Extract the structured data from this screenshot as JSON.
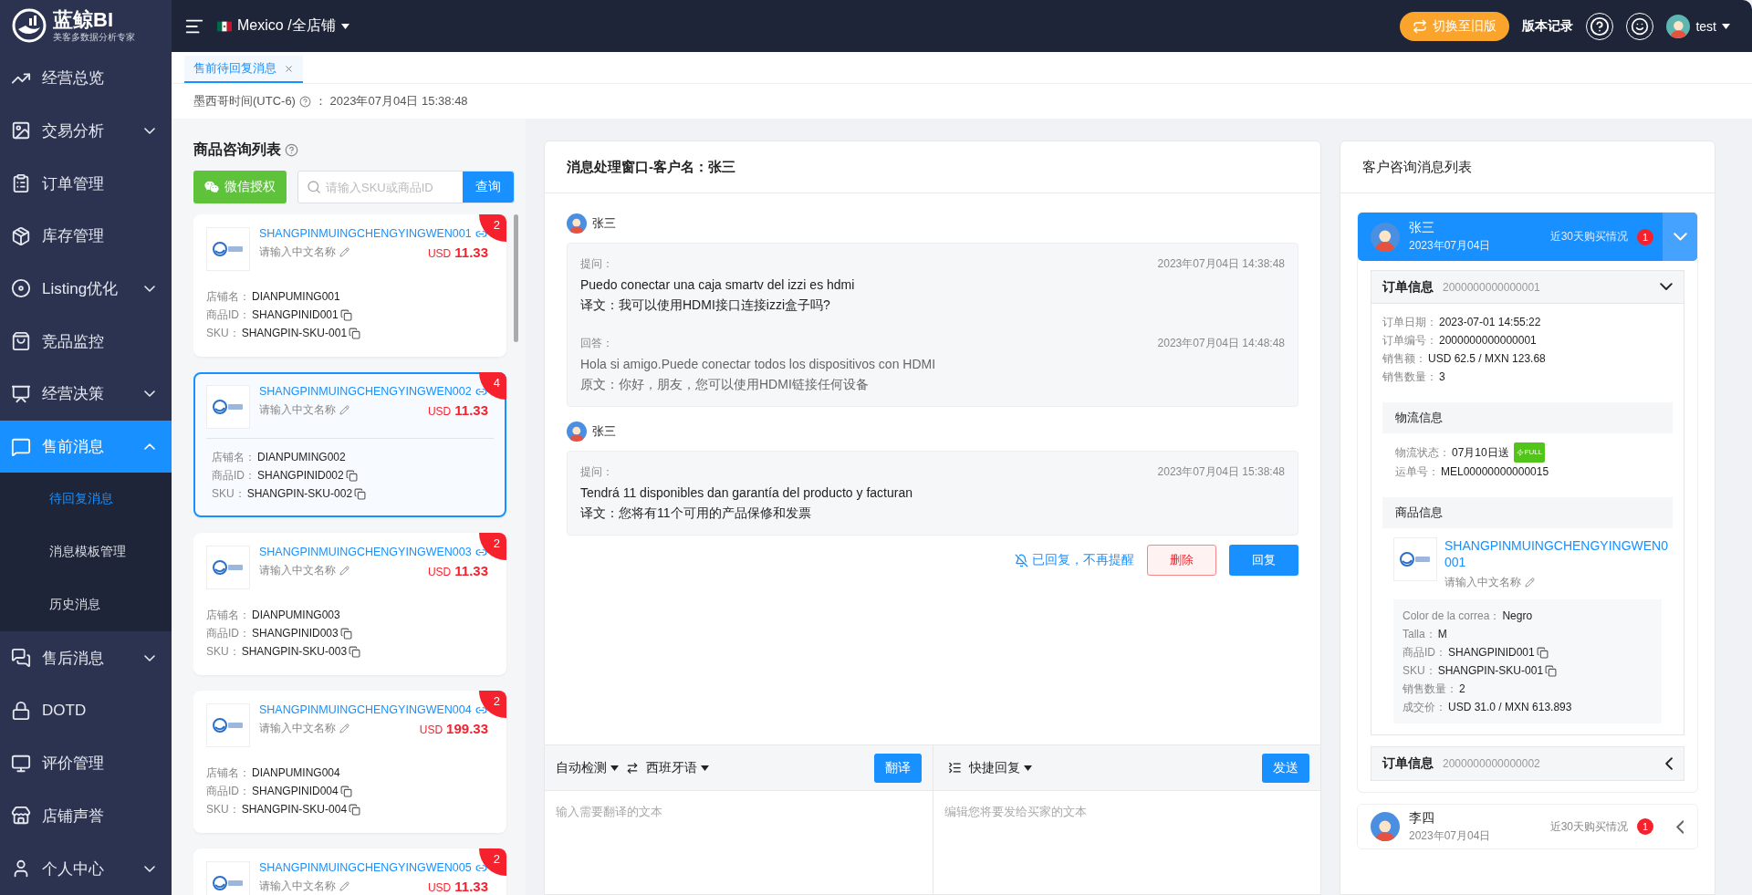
{
  "sidebar": {
    "logo": {
      "title": "蓝鲸BI",
      "subtitle": "美客多数据分析专家"
    },
    "items": [
      {
        "label": "经营总览",
        "selected": false
      },
      {
        "label": "交易分析",
        "expanded": false,
        "selected": false
      },
      {
        "label": "订单管理",
        "selected": false
      },
      {
        "label": "库存管理",
        "selected": false
      },
      {
        "label": "Listing优化",
        "expanded": false,
        "selected": false
      },
      {
        "label": "竞品监控",
        "selected": false
      },
      {
        "label": "经营决策",
        "expanded": false,
        "selected": false
      },
      {
        "label": "售前消息",
        "expanded": true,
        "selected": true,
        "children": [
          {
            "label": "待回复消息",
            "selected": true
          },
          {
            "label": "消息模板管理",
            "selected": false
          },
          {
            "label": "历史消息",
            "selected": false
          }
        ]
      },
      {
        "label": "售后消息",
        "expanded": false,
        "selected": false
      },
      {
        "label": "DOTD",
        "selected": false
      },
      {
        "label": "评价管理",
        "selected": false
      },
      {
        "label": "店铺声誉",
        "selected": false
      },
      {
        "label": "个人中心",
        "expanded": false,
        "selected": false
      }
    ]
  },
  "topbar": {
    "store": "Mexico /全店铺",
    "switch_button": "切换至旧版",
    "version_link": "版本记录",
    "user": "test"
  },
  "tabs": [
    {
      "label": "售前待回复消息",
      "selected": true
    }
  ],
  "time": {
    "label": "墨西哥时间(UTC-6)",
    "value": "： 2023年07月04日 15:38:48"
  },
  "product_list": {
    "title": "商品咨询列表",
    "wechat_button": "微信授权",
    "search_placeholder": "请输入SKU或商品ID",
    "search_button": "查询",
    "products": [
      {
        "title": "SHANGPINMUINGCHENGYINGWEN001",
        "name_placeholder": "请输入中文名称",
        "currency": "USD",
        "price": "11.33",
        "badge": "2",
        "selected": false,
        "fields": [
          {
            "label": "店铺名：",
            "value": "DIANPUMING001"
          },
          {
            "label": "商品ID：",
            "value": "SHANGPINID001",
            "copyable": true
          },
          {
            "label": "SKU：",
            "value": "SHANGPIN-SKU-001",
            "copyable": true
          }
        ]
      },
      {
        "title": "SHANGPINMUINGCHENGYINGWEN002",
        "name_placeholder": "请输入中文名称",
        "currency": "USD",
        "price": "11.33",
        "badge": "4",
        "selected": true,
        "fields": [
          {
            "label": "店铺名：",
            "value": "DIANPUMING002"
          },
          {
            "label": "商品ID：",
            "value": "SHANGPINID002",
            "copyable": true
          },
          {
            "label": "SKU：",
            "value": "SHANGPIN-SKU-002",
            "copyable": true
          }
        ]
      },
      {
        "title": "SHANGPINMUINGCHENGYINGWEN003",
        "name_placeholder": "请输入中文名称",
        "currency": "USD",
        "price": "11.33",
        "badge": "2",
        "selected": false,
        "fields": [
          {
            "label": "店铺名：",
            "value": "DIANPUMING003"
          },
          {
            "label": "商品ID：",
            "value": "SHANGPINID003",
            "copyable": true
          },
          {
            "label": "SKU：",
            "value": "SHANGPIN-SKU-003",
            "copyable": true
          }
        ]
      },
      {
        "title": "SHANGPINMUINGCHENGYINGWEN004",
        "name_placeholder": "请输入中文名称",
        "currency": "USD",
        "price": "199.33",
        "badge": "2",
        "selected": false,
        "fields": [
          {
            "label": "店铺名：",
            "value": "DIANPUMING004"
          },
          {
            "label": "商品ID：",
            "value": "SHANGPINID004",
            "copyable": true
          },
          {
            "label": "SKU：",
            "value": "SHANGPIN-SKU-004",
            "copyable": true
          }
        ]
      },
      {
        "title": "SHANGPINMUINGCHENGYINGWEN005",
        "name_placeholder": "请输入中文名称",
        "currency": "USD",
        "price": "11.33",
        "badge": "2",
        "selected": false
      }
    ]
  },
  "message_window": {
    "title": "消息处理窗口-客户名：张三",
    "threads": [
      {
        "customer": "张三",
        "entries": [
          {
            "kind": "question",
            "label": "提问：",
            "time": "2023年07月04日 14:38:48",
            "text": "Puedo conectar una caja smartv del izzi es hdmi",
            "translation_label": "译文：",
            "translation": "我可以使用HDMI接口连接izzi盒子吗?"
          },
          {
            "kind": "answer",
            "label": "回答：",
            "time": "2023年07月04日 14:48:48",
            "text": "Hola si amigo.Puede conectar todos los dispositivos con HDMI",
            "translation_label": "原文：",
            "translation": "你好，朋友，您可以使用HDMI链接任何设备"
          }
        ]
      },
      {
        "customer": "张三",
        "entries": [
          {
            "kind": "question",
            "label": "提问：",
            "time": "2023年07月04日 15:38:48",
            "text": "Tendrá 11 disponibles dan garantía del producto y facturan",
            "translation_label": "译文：",
            "translation": "您将有11个可用的产品保修和发票"
          }
        ]
      }
    ],
    "mute_link": "已回复，不再提醒",
    "delete_button": "删除",
    "reply_button": "回复",
    "translator": {
      "source_language": "自动检测",
      "target_language": "西班牙语",
      "translate_button": "翻译",
      "placeholder": "输入需要翻译的文本"
    },
    "composer": {
      "quick_reply": "快捷回复",
      "send_button": "发送",
      "placeholder": "编辑您将要发给买家的文本"
    }
  },
  "customer_list": {
    "title": "客户咨询消息列表",
    "customers": [
      {
        "name": "张三",
        "date": "2023年07月04日",
        "purchase_link": "近30天购买情况",
        "badge": "1",
        "expanded": true,
        "orders": [
          {
            "label": "订单信息",
            "number": "2000000000000001",
            "expanded": true,
            "fields": [
              {
                "label": "订单日期：",
                "value": "2023-07-01 14:55:22"
              },
              {
                "label": "订单编号：",
                "value": "2000000000000001"
              },
              {
                "label": "销售额：",
                "value": "USD 62.5 / MXN 123.68"
              },
              {
                "label": "销售数量：",
                "value": "3"
              }
            ],
            "logistics": {
              "title": "物流信息",
              "fields": [
                {
                  "label": "物流状态：",
                  "value": "07月10日送",
                  "tag": "FULL"
                },
                {
                  "label": "运单号：",
                  "value": "MEL00000000000015"
                }
              ]
            },
            "goods": {
              "title": "商品信息",
              "items": [
                {
                  "title": "SHANGPINMUINGCHENGYINGWEN0001",
                  "name_placeholder": "请输入中文名称",
                  "attributes": [
                    {
                      "label": "Color de la correa：",
                      "value": "Negro"
                    },
                    {
                      "label": "Talla：",
                      "value": "M"
                    },
                    {
                      "label": "商品ID：",
                      "value": "SHANGPINID001",
                      "copyable": true
                    },
                    {
                      "label": "SKU：",
                      "value": "SHANGPIN-SKU-001",
                      "copyable": true
                    },
                    {
                      "label": "销售数量：",
                      "value": "2"
                    },
                    {
                      "label": "成交价：",
                      "value": "USD 31.0 / MXN 613.893"
                    }
                  ]
                }
              ]
            }
          },
          {
            "label": "订单信息",
            "number": "2000000000000002",
            "expanded": false
          }
        ]
      },
      {
        "name": "李四",
        "date": "2023年07月04日",
        "purchase_link": "近30天购买情况",
        "badge": "1",
        "expanded": false
      }
    ]
  }
}
